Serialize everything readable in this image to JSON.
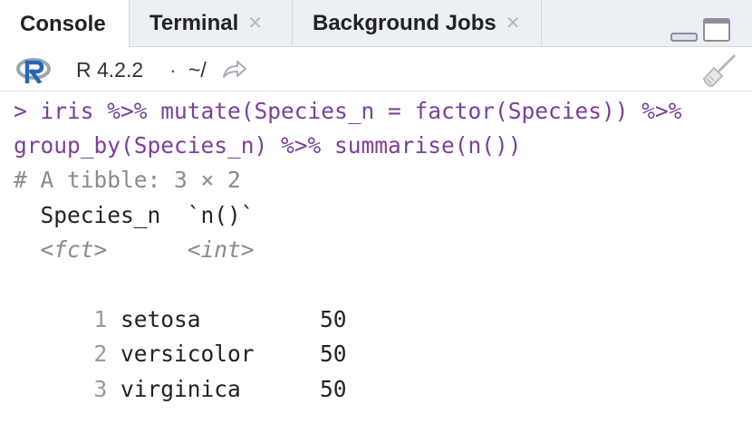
{
  "tabs": [
    {
      "label": "Console",
      "active": true,
      "closable": false
    },
    {
      "label": "Terminal",
      "active": false,
      "closable": true
    },
    {
      "label": "Background Jobs",
      "active": false,
      "closable": true
    }
  ],
  "header": {
    "r_version": "R 4.2.2",
    "separator": "·",
    "path": "~/"
  },
  "console": {
    "command_line_1": "> iris %>% mutate(Species_n = factor(Species)) %>%",
    "command_line_2": "group_by(Species_n) %>% summarise(n())",
    "tibble_header": "# A tibble: 3 × 2",
    "columns_line": "  Species_n  `n()`",
    "types_line": "  <fct>      <int>",
    "rows": [
      {
        "idx": "1",
        "species": "setosa",
        "n": "50"
      },
      {
        "idx": "2",
        "species": "versicolor",
        "n": "50"
      },
      {
        "idx": "3",
        "species": "virginica",
        "n": "50"
      }
    ]
  },
  "colors": {
    "command": "#7d3f98",
    "muted": "#8b8b8b",
    "tabbar_bg": "#eceff3"
  },
  "icons": {
    "r_logo": "r-logo-icon",
    "share": "share-arrow-icon",
    "clear": "broom-icon",
    "close": "close-icon",
    "minimize": "minimize-icon",
    "maximize": "maximize-icon"
  }
}
